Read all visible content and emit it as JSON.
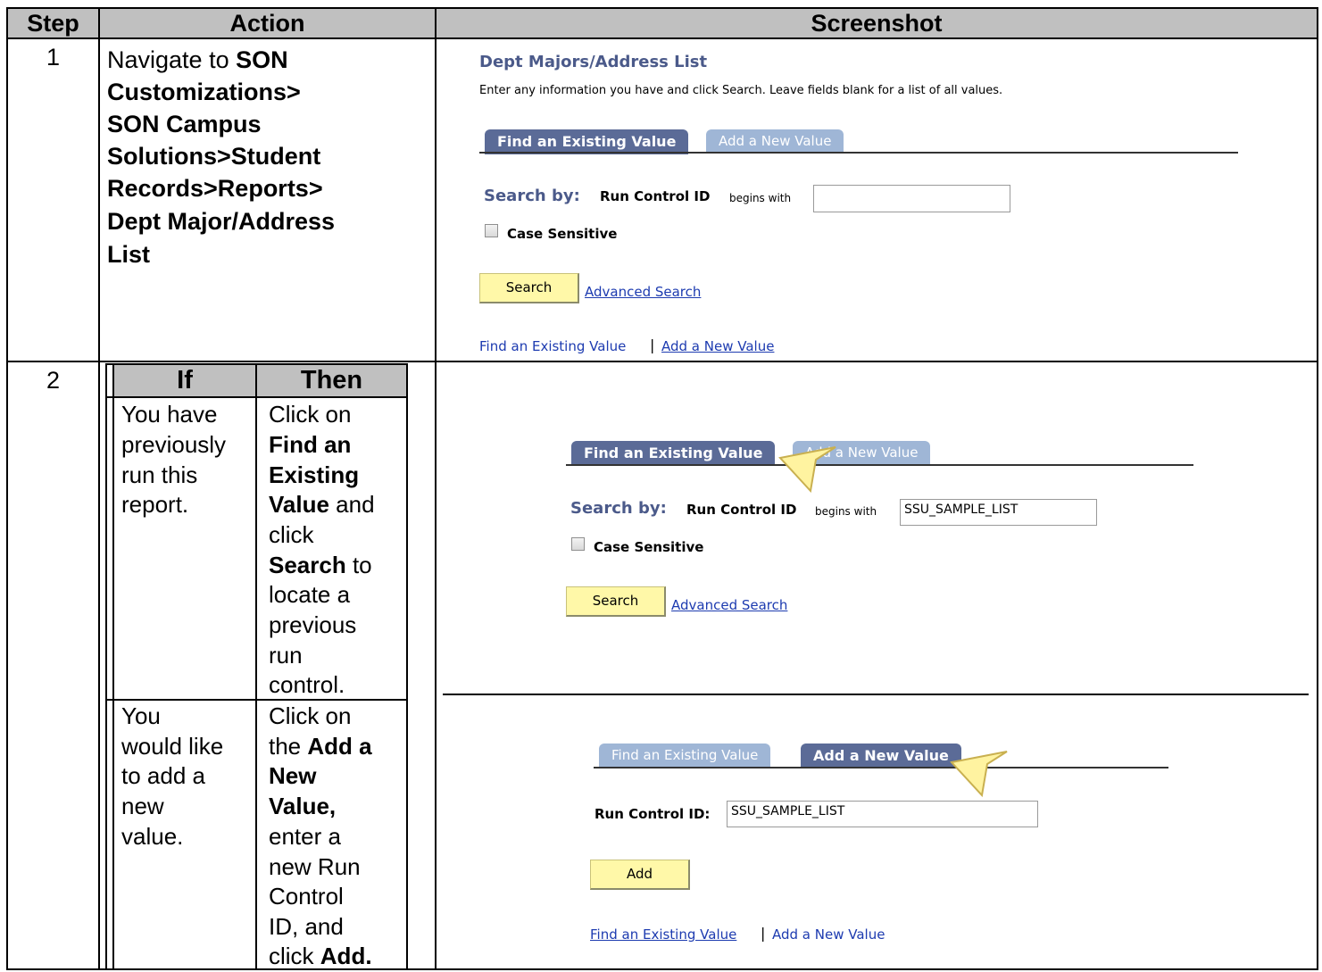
{
  "headers": {
    "step": "Step",
    "action": "Action",
    "screenshot": "Screenshot"
  },
  "step1": {
    "number": "1",
    "action_lines": [
      "Navigate to SON",
      "Customizations>",
      "SON Campus",
      "Solutions>Student",
      "Records>Reports>",
      "Dept Major/Address",
      "List"
    ],
    "screen": {
      "title": "Dept Majors/Address List",
      "instructions": "Enter any information you have and click Search. Leave fields blank for a list of all values.",
      "tab_find": "Find an Existing Value",
      "tab_add": "Add a New Value",
      "search_by": "Search by:",
      "run_control_label": "Run Control ID",
      "begins_with": "begins with",
      "input_value": "",
      "case_sensitive": "Case Sensitive",
      "search_button": "Search",
      "advanced_search": "Advanced Search",
      "footer_find": "Find an Existing Value",
      "footer_sep": "|",
      "footer_add": "Add a New Value"
    }
  },
  "step2": {
    "number": "2",
    "if_header": "If",
    "then_header": "Then",
    "rows": [
      {
        "if_lines": [
          "You have",
          "previously",
          "run this",
          "report."
        ]
      },
      {
        "if_lines": [
          "You",
          "would like",
          "to add a",
          "new",
          "value."
        ]
      }
    ],
    "then_row1": {
      "l1": "Click on",
      "l2": "Find an",
      "l3": "Existing",
      "l4a": "Value",
      "l4b": " and",
      "l5": "click",
      "l6a": "Search",
      "l6b": " to",
      "l7": "locate a",
      "l8": "previous",
      "l9": "run",
      "l10": "control."
    },
    "then_row2": {
      "l1": "Click on",
      "l2a": "the ",
      "l2b": "Add a",
      "l3": "New",
      "l4": "Value,",
      "l5": "enter a",
      "l6": "new Run",
      "l7": "Control",
      "l8": "ID, and",
      "l9a": "click ",
      "l9b": "Add."
    },
    "screen1": {
      "tab_find": "Find an Existing Value",
      "tab_add": "Add a New Value",
      "search_by": "Search by:",
      "run_control_label": "Run Control ID",
      "begins_with": "begins with",
      "input_value": "SSU_SAMPLE_LIST",
      "case_sensitive": "Case Sensitive",
      "search_button": "Search",
      "advanced_search": "Advanced Search"
    },
    "screen2": {
      "tab_find": "Find an Existing Value",
      "tab_add": "Add a New Value",
      "run_control_label": "Run Control ID:",
      "input_value": "SSU_SAMPLE_LIST",
      "add_button": "Add",
      "footer_find": "Find an Existing Value",
      "footer_sep": "|",
      "footer_add": "Add a New Value"
    }
  },
  "colors": {
    "header_bg": "#c0c0c0",
    "tab_active": "#5b6b97",
    "tab_inactive": "#9fb6d6",
    "button_bg": "#fff8a8",
    "link": "#1d3bb0",
    "callout": "#fff3a0"
  }
}
